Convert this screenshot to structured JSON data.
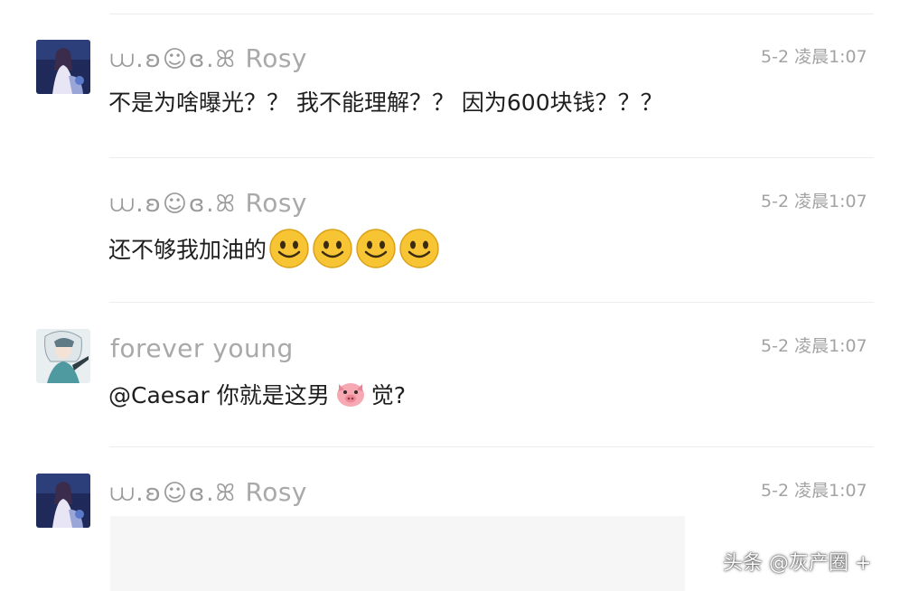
{
  "comments": [
    {
      "author_deco": "⩊.ʚ☺ɞ.ꕤ",
      "author": "Rosy",
      "time": "5-2 凌晨1:07",
      "text": "不是为啥曝光？？ 我不能理解？？ 因为600块钱？？？",
      "avatar": "avatar-rosy"
    },
    {
      "author_deco": "⩊.ʚ☺ɞ.ꕤ",
      "author": "Rosy",
      "time": "5-2 凌晨1:07",
      "text": "还不够我加油的",
      "emoji_count": 4,
      "emoji": "smile-emoji"
    },
    {
      "author": "forever young",
      "time": "5-2 凌晨1:07",
      "text_before": "@Caesar 你就是这男",
      "emoji": "pig-emoji",
      "text_after": "觉?",
      "avatar": "avatar-forever-young"
    },
    {
      "author_deco": "⩊.ʚ☺ɞ.ꕤ",
      "author": "Rosy",
      "time": "5-2 凌晨1:07",
      "avatar": "avatar-rosy"
    }
  ],
  "watermark": "头条 @灰产圈 +"
}
